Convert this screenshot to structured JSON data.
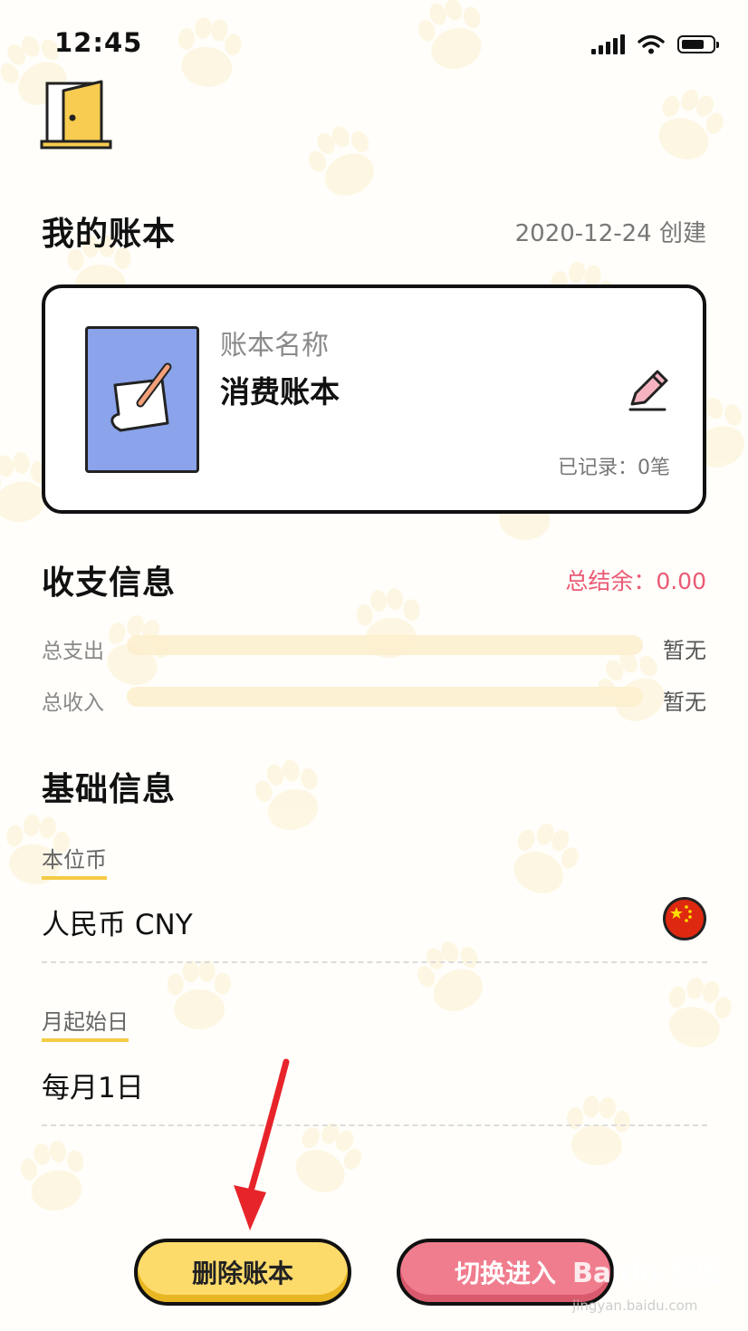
{
  "status_bar": {
    "time": "12:45"
  },
  "book_section": {
    "title": "我的账本",
    "created": "2020-12-24 创建"
  },
  "book_card": {
    "label": "账本名称",
    "name": "消费账本",
    "record_count": "已记录：0笔"
  },
  "finance_section": {
    "title": "收支信息",
    "balance": "总结余：0.00",
    "rows": [
      {
        "label": "总支出",
        "value": "暂无"
      },
      {
        "label": "总收入",
        "value": "暂无"
      }
    ]
  },
  "basic_section": {
    "title": "基础信息",
    "currency": {
      "label": "本位币",
      "value": "人民币 CNY"
    },
    "month_start": {
      "label": "月起始日",
      "value": "每月1日"
    }
  },
  "buttons": {
    "delete": "删除账本",
    "switch": "切换进入"
  },
  "watermark": {
    "main": "Baidu 经验",
    "sub": "jingyan.baidu.com"
  },
  "colors": {
    "accent_yellow": "#fddb6b",
    "accent_pink": "#f07d8e",
    "balance_pink": "#ea5a74",
    "book_blue": "#8aa3ea",
    "arrow_red": "#e8242b"
  },
  "icons": [
    "door-icon",
    "notepad-icon",
    "pencil-icon",
    "china-flag-icon",
    "signal-icon",
    "wifi-icon",
    "battery-icon"
  ]
}
